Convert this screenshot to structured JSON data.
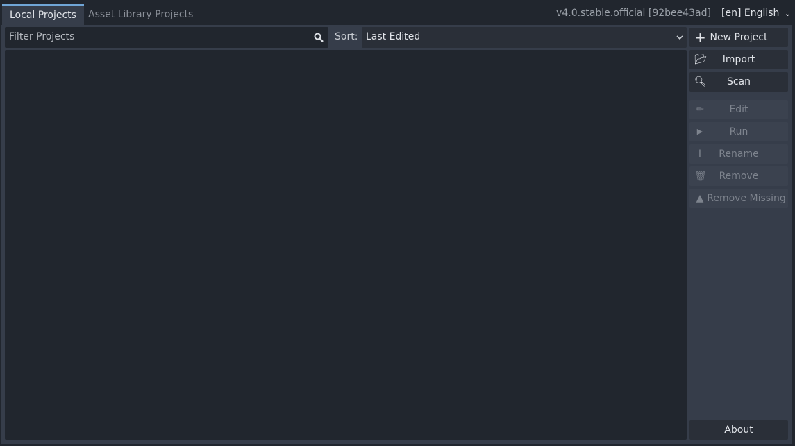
{
  "tabs": [
    {
      "label": "Local Projects",
      "active": true
    },
    {
      "label": "Asset Library Projects",
      "active": false
    }
  ],
  "version": "v4.0.stable.official [92bee43ad]",
  "language": "[en] English",
  "filter": {
    "placeholder": "Filter Projects",
    "value": ""
  },
  "sort": {
    "label": "Sort:",
    "selected": "Last Edited"
  },
  "buttons": {
    "new_project": "New Project",
    "import": "Import",
    "scan": "Scan",
    "edit": "Edit",
    "run": "Run",
    "rename": "Rename",
    "remove": "Remove",
    "remove_missing": "Remove Missing",
    "about": "About"
  },
  "colors": {
    "accent": "#70a5d6",
    "background": "#363d4a",
    "field": "#21262e"
  }
}
